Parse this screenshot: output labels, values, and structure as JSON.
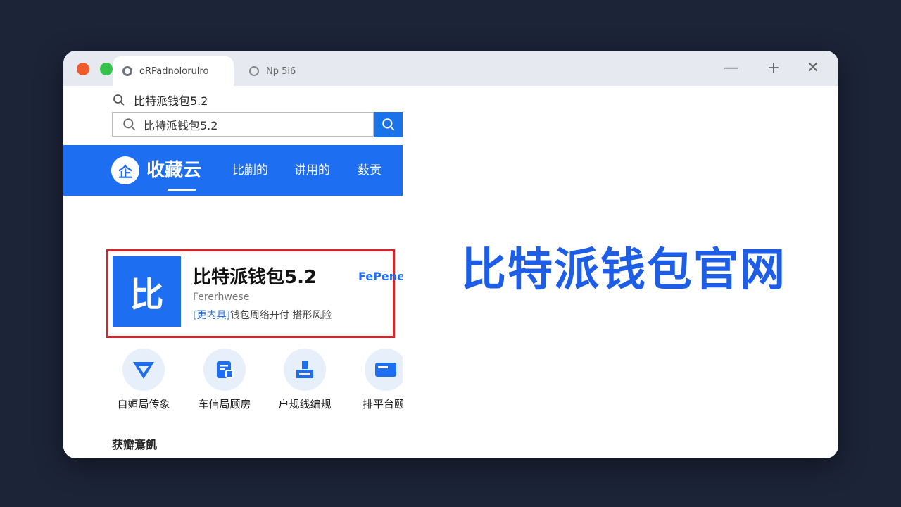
{
  "browser": {
    "active_tab_title": "oRPadnolorulro",
    "inactive_tab_title": "Np 5i6",
    "window_controls": {
      "minimize": "—",
      "maximize": "+",
      "close": "✕"
    }
  },
  "search": {
    "query_text": "比特派钱包5.2",
    "input_value": "比特派钱包5.2"
  },
  "site_nav": {
    "logo_glyph": "企",
    "brand": "收藏云",
    "links": [
      "比蒯的",
      "讲用的",
      "薮贡"
    ]
  },
  "result": {
    "icon_text": "比",
    "title": "比特派钱包5.2",
    "subtitle": "Fererhwese",
    "desc_bracket": "[更内具]",
    "desc_rest": "钱包周络开付  搭形风险",
    "link": "FePenea"
  },
  "quick_links": [
    {
      "label": "自姮局传象",
      "icon": "shield-icon"
    },
    {
      "label": "车信局顾房",
      "icon": "document-icon"
    },
    {
      "label": "户规线编规",
      "icon": "tool-icon"
    },
    {
      "label": "排平台颐!",
      "icon": "card-icon"
    }
  ],
  "section": {
    "title": "获瓣鴍飢"
  },
  "hero": {
    "title": "比特派钱包官网"
  },
  "colors": {
    "brand_blue": "#1e6ef2",
    "highlight_red": "#d8242a",
    "background": "#1c2438"
  }
}
